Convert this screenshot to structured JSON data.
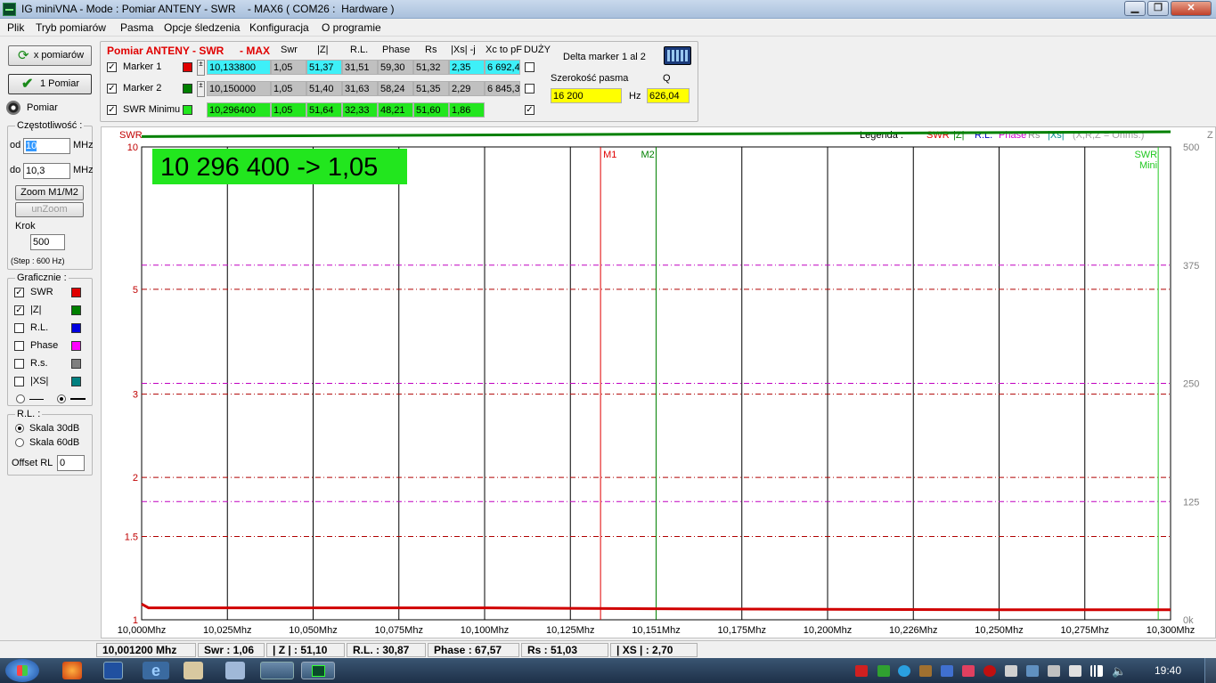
{
  "window": {
    "title": "IG miniVNA - Mode : Pomiar ANTENY - SWR    - MAX6 ( COM26 :  Hardware )"
  },
  "menu": [
    "Plik",
    "Tryb pomiarów",
    "Pasma",
    "Opcje śledzenia",
    "Konfiguracja",
    "O programie"
  ],
  "left": {
    "x_btn": "x pomiarów",
    "one_btn": "1 Pomiar",
    "pomiar": "Pomiar",
    "freq_title": "Częstotliwość :",
    "od_label": "od",
    "od_value": "10",
    "od_unit": "MHz",
    "do_label": "do",
    "do_value": "10,3",
    "do_unit": "MHz",
    "zoom_btn": "Zoom M1/M2",
    "unzoom_btn": "unZoom",
    "krok_label": "Krok",
    "krok_value": "500",
    "step_note": "(Step : 600 Hz)",
    "graf_title": "Graficznie :",
    "graf_items": [
      {
        "label": "SWR",
        "checked": true,
        "color": "#e00000"
      },
      {
        "label": "|Z|",
        "checked": true,
        "color": "#008000"
      },
      {
        "label": "R.L.",
        "checked": false,
        "color": "#0000e0"
      },
      {
        "label": "Phase",
        "checked": false,
        "color": "#ff00ff"
      },
      {
        "label": "R.s.",
        "checked": false,
        "color": "#808080"
      },
      {
        "label": "|XS|",
        "checked": false,
        "color": "#008080"
      }
    ],
    "rl_title": "R.L. :",
    "skala30": "Skala 30dB",
    "skala60": "Skala 60dB",
    "offset_label": "Offset RL",
    "offset_value": "0"
  },
  "table": {
    "title": "Pomiar ANTENY - SWR",
    "max": "- MAX",
    "headers": [
      "Swr",
      "|Z|",
      "R.L.",
      "Phase",
      "Rs",
      "|Xs| -j",
      "Xc to pF",
      "DUŻY"
    ],
    "rows": [
      {
        "label": "Marker 1",
        "checked": true,
        "color": "#e00000",
        "cells": [
          "10,133800",
          "1,05",
          "51,37",
          "31,51",
          "59,30",
          "51,32",
          "2,35",
          "6 692,4"
        ],
        "big": false
      },
      {
        "label": "Marker 2",
        "checked": true,
        "color": "#008000",
        "cells": [
          "10,150000",
          "1,05",
          "51,40",
          "31,63",
          "58,24",
          "51,35",
          "2,29",
          "6 845,3"
        ],
        "big": false
      },
      {
        "label": "SWR Minimu",
        "checked": true,
        "color": "#22e61e",
        "cells": [
          "10,296400",
          "1,05",
          "51,64",
          "32,33",
          "48,21",
          "51,60",
          "1,86"
        ],
        "big": true
      }
    ],
    "delta_title": "Delta marker 1 al 2",
    "bandwidth_label": "Szerokość pasma",
    "q_label": "Q",
    "bandwidth_value": "16 200",
    "hz_label": "Hz",
    "q_value": "626,04"
  },
  "chart_data": {
    "type": "line",
    "big_readout": "10 296 400 -> 1,05",
    "left_axis_label": "SWR",
    "right_axis_label": "Z",
    "legend_label": "Legenda :",
    "legend": [
      {
        "text": "SWR",
        "color": "#e00000"
      },
      {
        "text": "|Z|",
        "color": "#008000"
      },
      {
        "text": "R.L.",
        "color": "#0000c0"
      },
      {
        "text": "Phase",
        "color": "#d000d0"
      },
      {
        "text": "Rs",
        "color": "#909090"
      },
      {
        "text": "|Xs|",
        "color": "#008b8b"
      },
      {
        "text": "(X,R,Z = Ohms.)",
        "color": "#a0a0a0"
      }
    ],
    "x_ticks": [
      "10,000Mhz",
      "10,025Mhz",
      "10,050Mhz",
      "10,075Mhz",
      "10,100Mhz",
      "10,125Mhz",
      "10,151Mhz",
      "10,175Mhz",
      "10,200Mhz",
      "10,226Mhz",
      "10,250Mhz",
      "10,275Mhz",
      "10,300Mhz"
    ],
    "x_range": [
      10.0,
      10.3
    ],
    "swr_ticks": [
      {
        "label": "10",
        "value": 10
      },
      {
        "label": "5",
        "value": 5
      },
      {
        "label": "3",
        "value": 3
      },
      {
        "label": "2",
        "value": 2
      },
      {
        "label": "1.5",
        "value": 1.5
      },
      {
        "label": "1",
        "value": 1
      }
    ],
    "z_ticks": [
      {
        "label": "500",
        "value": 500
      },
      {
        "label": "375",
        "value": 375
      },
      {
        "label": "250",
        "value": 250
      },
      {
        "label": "125",
        "value": 125
      },
      {
        "label": "0k",
        "value": 0
      }
    ],
    "swr_scale": "log",
    "swr_range": [
      1,
      10
    ],
    "z_range": [
      0,
      500
    ],
    "markers": [
      {
        "label": "M1",
        "freq": 10.1338,
        "color": "#e00000"
      },
      {
        "label": "M2",
        "freq": 10.15,
        "color": "#008000"
      },
      {
        "label": "SWR",
        "label2": "Mini",
        "freq": 10.2964,
        "color": "#22c822"
      }
    ],
    "series": [
      {
        "name": "SWR",
        "color": "#d00000",
        "x": [
          10.0,
          10.002,
          10.05,
          10.1,
          10.15,
          10.2,
          10.25,
          10.3
        ],
        "values": [
          1.08,
          1.06,
          1.06,
          1.06,
          1.055,
          1.052,
          1.05,
          1.05
        ]
      },
      {
        "name": "|Z|",
        "color": "#008000",
        "x": [
          10.0,
          10.3
        ],
        "values": [
          51.1,
          51.6
        ]
      }
    ]
  },
  "status": {
    "freq": "10,001200 Mhz",
    "swr": "Swr : 1,06",
    "z": "| Z | : 51,10",
    "rl": "R.L. : 30,87",
    "phase": "Phase : 67,57",
    "rs": "Rs : 51,03",
    "xs": "| XS | : 2,70"
  },
  "taskbar": {
    "clock": "19:40"
  }
}
